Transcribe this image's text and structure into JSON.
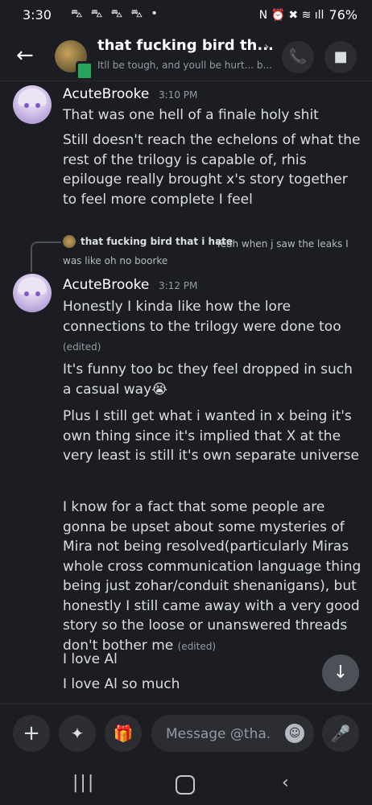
{
  "status_bar": {
    "time": "3:30",
    "notification_icons": "⛍ ⛍ ⛍ ⛍ •",
    "right_icons": "N ⏰ ✖ ≋ ıll",
    "battery": "76%"
  },
  "header": {
    "title": "that fucking bird th...",
    "subtitle": "Itll be tough, and youll be hurt... b..."
  },
  "messages": {
    "group1": {
      "username": "AcuteBrooke",
      "timestamp": "3:10 PM",
      "lines": [
        "That was one hell of a finale holy shit",
        "Still doesn't reach the echelons of what the rest of the trilogy is capable of, rhis epilouge really brought x's story together to feel more complete I feel"
      ]
    },
    "reply": {
      "name": "that fucking bird that i hate",
      "text": "Yeah when j saw the leaks I was like oh no boorke"
    },
    "group2": {
      "username": "AcuteBrooke",
      "timestamp": "3:12 PM",
      "m1": "Honestly I kinda like how the lore connections to the trilogy were done too",
      "m1_edited": "(edited)",
      "m2": "It's funny too bc they feel dropped in such a casual way",
      "m2_emoji": "😭",
      "m3": "Plus I still get what i wanted in x being it's own thing since it's implied that X at the very least is still it's own separate universe",
      "m4": "I know for a fact that some people are gonna be upset about some mysteries of Mira not being resolved(particularly Miras whole cross communication language thing being just zohar/conduit shenanigans), but honestly I still came away with a very good story so the loose or unanswered threads don't bother me",
      "m4_edited": "(edited)",
      "m5": "I love Al",
      "m6": "I love Al so much"
    }
  },
  "composer": {
    "placeholder": "Message @tha..."
  },
  "icons": {
    "back": "←",
    "call": "📞",
    "video": "■",
    "chevron": "›",
    "scroll_down": "↓",
    "plus": "+",
    "apps": "✦",
    "gift": "🎁",
    "emoji": "☺",
    "mic": "🎤",
    "nav_recent": "|||",
    "nav_back": "‹"
  },
  "colors": {
    "background": "#1c1d22",
    "online": "#23a55a",
    "muted_text": "#949ba4"
  }
}
